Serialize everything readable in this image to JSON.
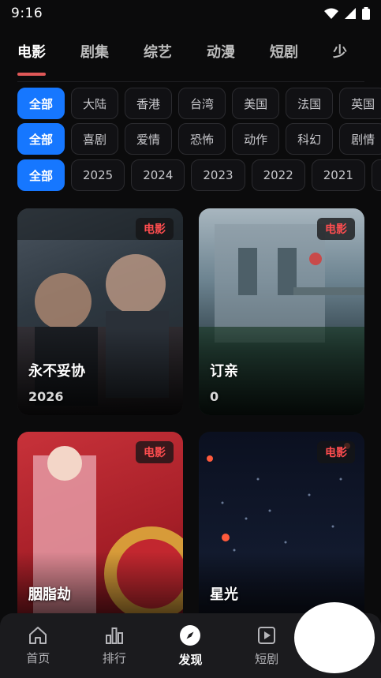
{
  "status_bar": {
    "time": "9:16"
  },
  "tabs": [
    {
      "label": "电影",
      "active": true
    },
    {
      "label": "剧集"
    },
    {
      "label": "综艺"
    },
    {
      "label": "动漫"
    },
    {
      "label": "短剧"
    },
    {
      "label": "少"
    }
  ],
  "filters": {
    "region": [
      "全部",
      "大陆",
      "香港",
      "台湾",
      "美国",
      "法国",
      "英国"
    ],
    "genre": [
      "全部",
      "喜剧",
      "爱情",
      "恐怖",
      "动作",
      "科幻",
      "剧情"
    ],
    "year": [
      "全部",
      "2025",
      "2024",
      "2023",
      "2022",
      "2021",
      ""
    ]
  },
  "cards": [
    {
      "badge": "电影",
      "title": "永不妥协",
      "year": "2026"
    },
    {
      "badge": "电影",
      "title": "订亲",
      "year": "0"
    },
    {
      "badge": "电影",
      "title": "胭脂劫",
      "year": ""
    },
    {
      "badge": "电影",
      "title": "星光",
      "year": ""
    }
  ],
  "bottom_nav": [
    {
      "label": "首页",
      "icon": "home-icon"
    },
    {
      "label": "排行",
      "icon": "bar-chart-icon"
    },
    {
      "label": "发现",
      "icon": "compass-icon",
      "active": true
    },
    {
      "label": "短剧",
      "icon": "play-square-icon"
    },
    {
      "label": ""
    }
  ],
  "colors": {
    "accent": "#1677ff",
    "tab_underline": "#e05858",
    "badge_text": "#ff4d4f"
  }
}
